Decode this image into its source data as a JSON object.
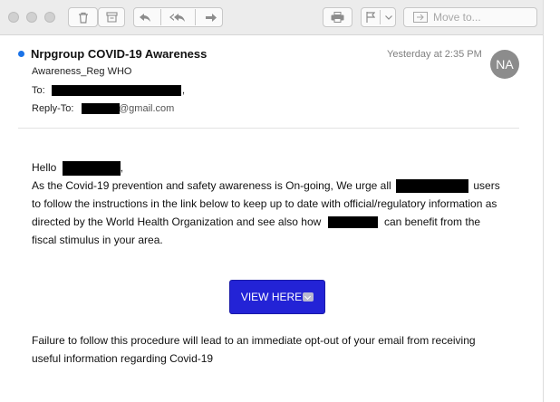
{
  "toolbar": {
    "move_to_label": "Move to..."
  },
  "message": {
    "sender_name": "Nrpgroup COVID-19 Awareness",
    "sender_display": "Awareness_Reg WHO",
    "timestamp": "Yesterday at 2:35 PM",
    "avatar_initials": "NA",
    "to_label": "To:",
    "reply_to_label": "Reply-To:",
    "reply_to_domain": "@gmail.com",
    "unread_color": "#1a73e8"
  },
  "body": {
    "greeting": "Hello",
    "para1_line1_a": "As the Covid-19 prevention and safety awareness is On-going, We urge all",
    "para1_line1_b": "users",
    "para1_line2": "to follow the instructions in the link below to keep up to date with official/regulatory information as",
    "para1_line3_a": "directed by the World Health Organization and see also how",
    "para1_line3_b": "can benefit from the",
    "para1_line4": "fiscal stimulus in your area.",
    "cta_label": "VIEW HERE",
    "cta_color": "#2323d6",
    "para2_line1": "Failure to follow this procedure will lead to an immediate opt-out of your email from receiving",
    "para2_line2": "useful information regarding Covid-19"
  }
}
